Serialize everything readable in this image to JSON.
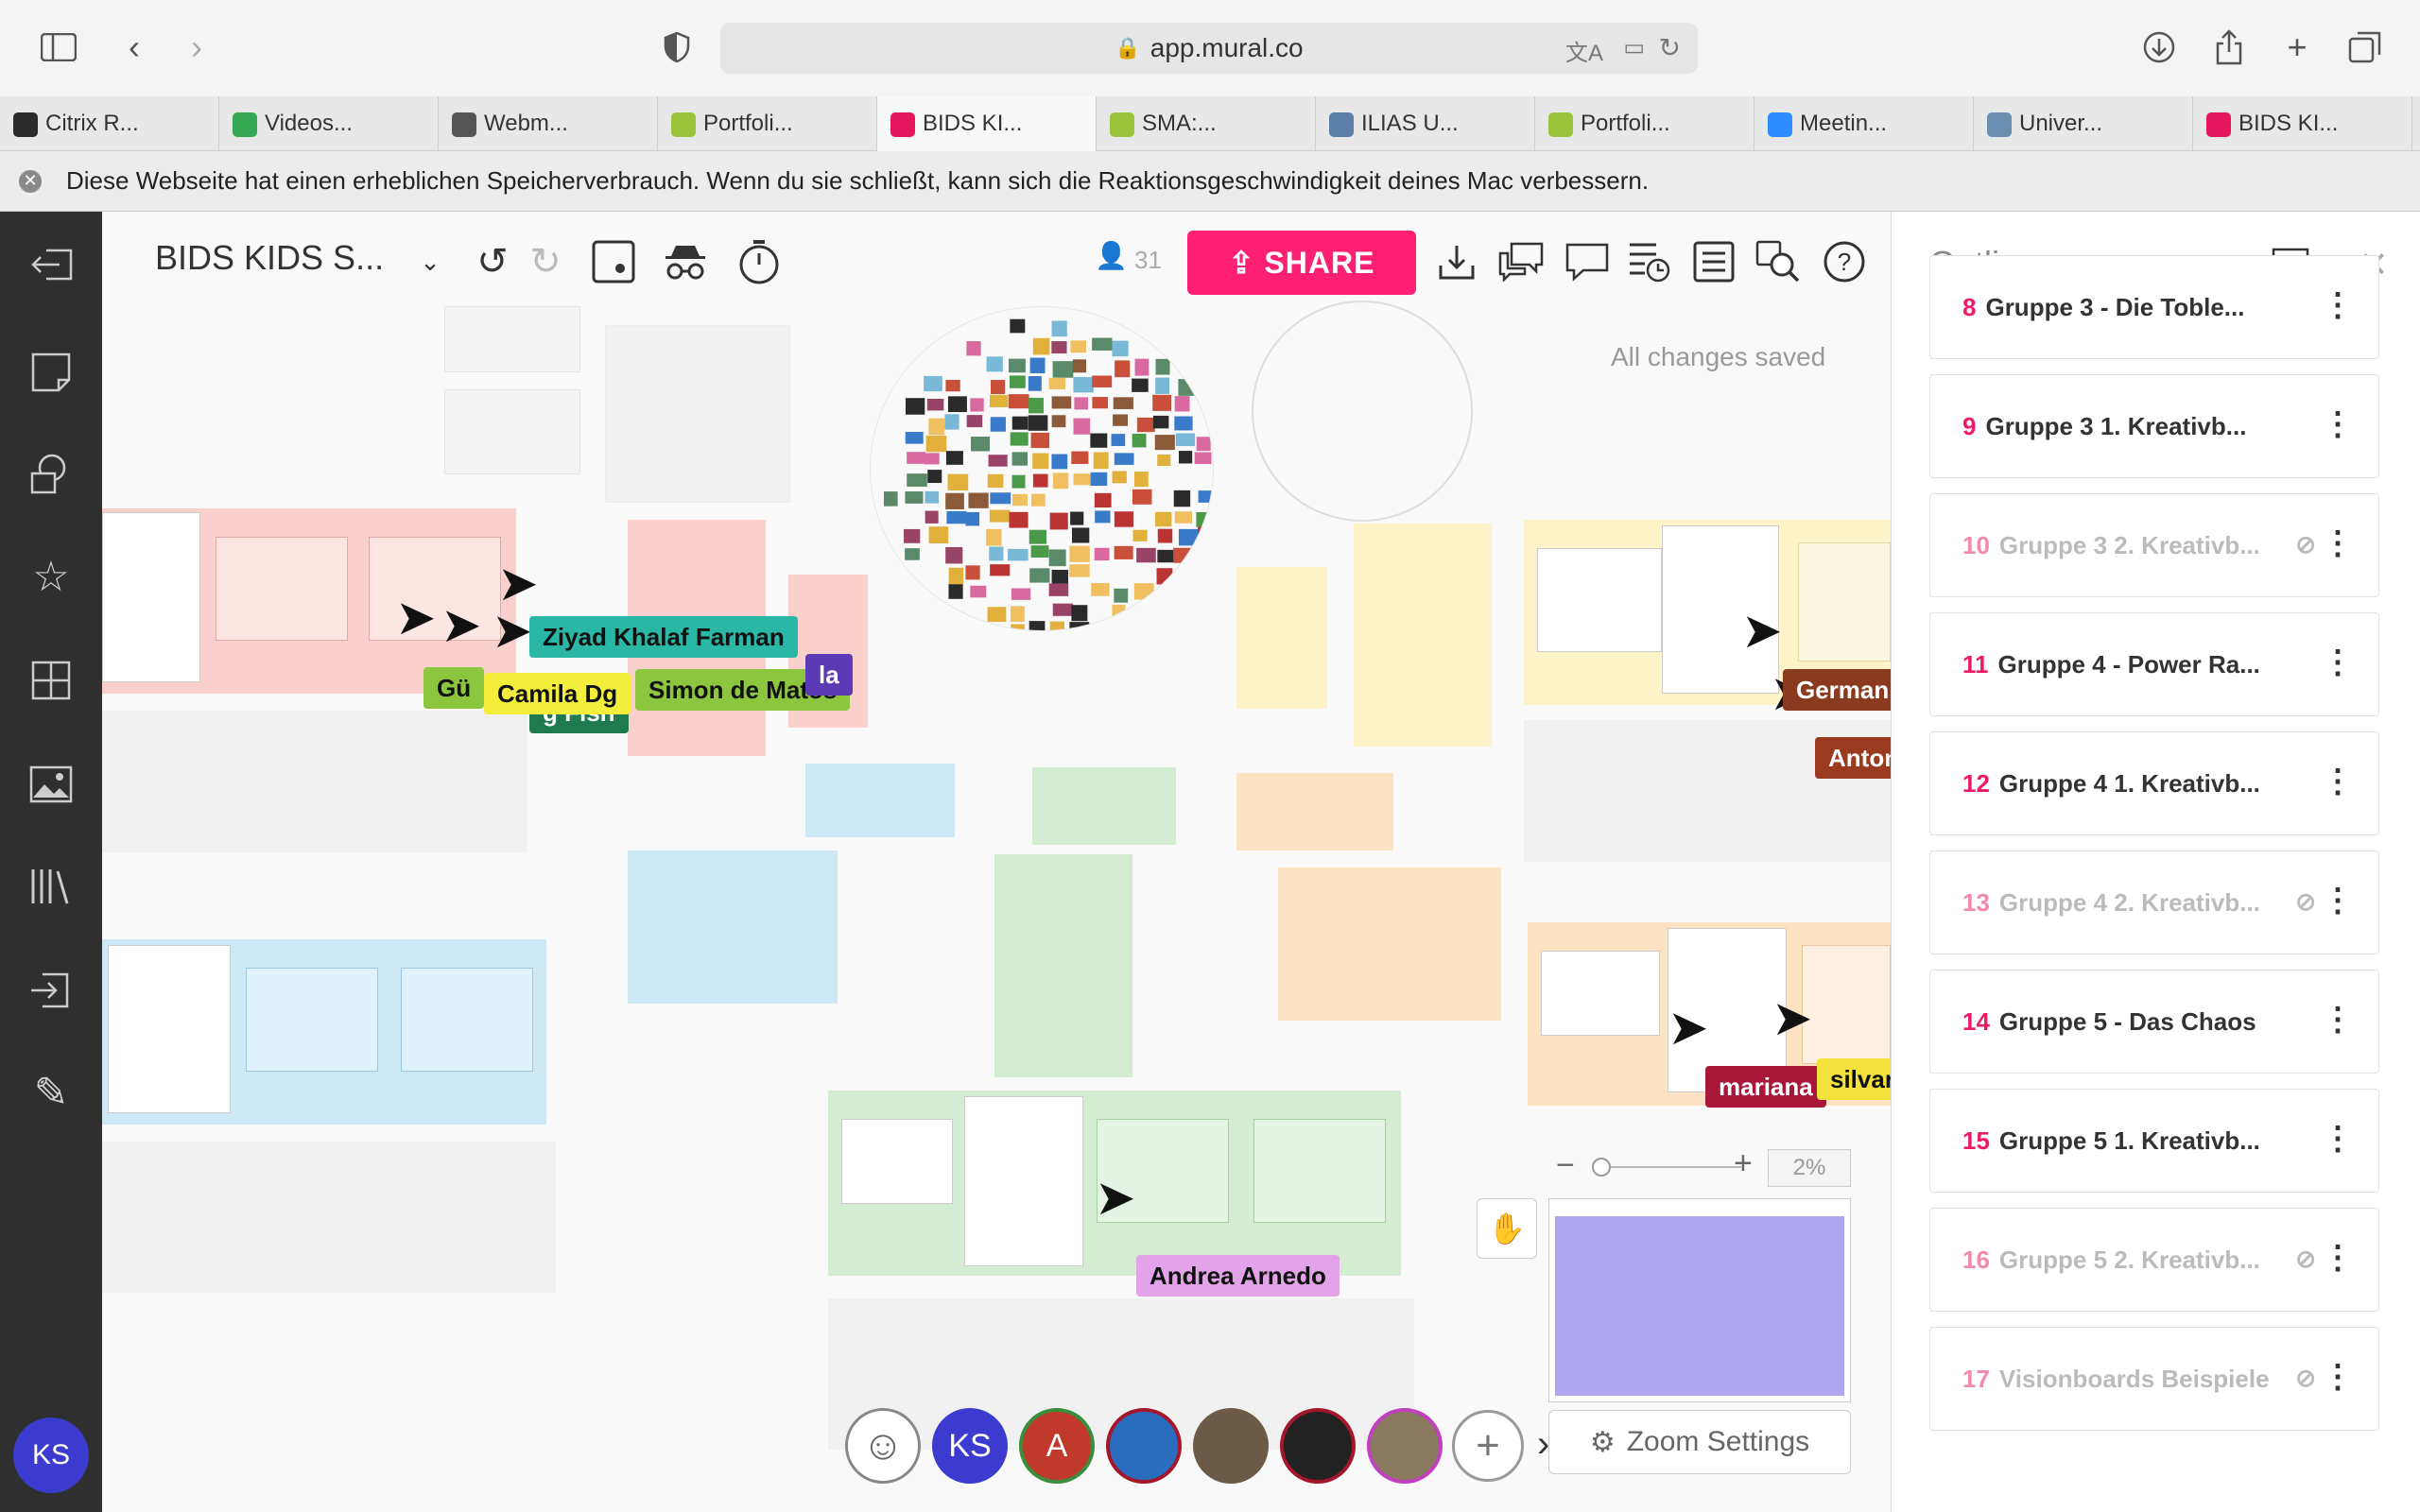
{
  "browser": {
    "url": "app.mural.co",
    "tabs": [
      {
        "label": "Citrix R...",
        "color": "#2b2b2b"
      },
      {
        "label": "Videos...",
        "color": "#34a853"
      },
      {
        "label": "Webm...",
        "color": "#555555"
      },
      {
        "label": "Portfoli...",
        "color": "#9bc53d"
      },
      {
        "label": "BIDS KI...",
        "color": "#e5175e"
      },
      {
        "label": "SMA:...",
        "color": "#9bc53d"
      },
      {
        "label": "ILIAS U...",
        "color": "#5b7fa6"
      },
      {
        "label": "Portfoli...",
        "color": "#9bc53d"
      },
      {
        "label": "Meetin...",
        "color": "#2d8cff"
      },
      {
        "label": "Univer...",
        "color": "#6b8fb0"
      },
      {
        "label": "BIDS KI...",
        "color": "#e5175e"
      }
    ],
    "active_tab": 4,
    "warning": "Diese Webseite hat einen erheblichen Speicherverbrauch. Wenn du sie schließt, kann sich die Reaktionsgeschwindigkeit deines Mac verbessern."
  },
  "mural": {
    "title": "BIDS KIDS S...",
    "participant_count": "31",
    "share_label": "SHARE",
    "save_status": "All changes saved"
  },
  "outline": {
    "title": "Outline",
    "items": [
      {
        "num": "8",
        "label": "Gruppe 3 - Die Toble...",
        "hidden": false
      },
      {
        "num": "9",
        "label": "Gruppe 3 1. Kreativb...",
        "hidden": false
      },
      {
        "num": "10",
        "label": "Gruppe 3 2. Kreativb...",
        "hidden": true
      },
      {
        "num": "11",
        "label": "Gruppe 4 - Power Ra...",
        "hidden": false
      },
      {
        "num": "12",
        "label": "Gruppe 4 1. Kreativb...",
        "hidden": false
      },
      {
        "num": "13",
        "label": "Gruppe 4 2. Kreativb...",
        "hidden": true
      },
      {
        "num": "14",
        "label": "Gruppe 5 - Das Chaos",
        "hidden": false
      },
      {
        "num": "15",
        "label": "Gruppe 5 1. Kreativb...",
        "hidden": false
      },
      {
        "num": "16",
        "label": "Gruppe 5 2. Kreativb...",
        "hidden": true
      },
      {
        "num": "17",
        "label": "Visionboards Beispiele",
        "hidden": true
      }
    ]
  },
  "collaborators": [
    {
      "name": "Ziyad Khalaf Farman",
      "color": "#2bb7a6"
    },
    {
      "name": "Gü",
      "color": "#8cc63f"
    },
    {
      "name": "Camila Dg",
      "color": "#f2ee3b"
    },
    {
      "name": "Simon de Matos",
      "color": "#8cc63f"
    },
    {
      "name": "g Fish",
      "color": "#1f7a4f",
      "text_color": "#ffffff"
    },
    {
      "name": "la",
      "color": "#5b3bb5",
      "text_color": "#ffffff"
    },
    {
      "name": "German",
      "color": "#8a3a1e",
      "text_color": "#ffffff"
    },
    {
      "name": "Anton",
      "color": "#9a3a1e",
      "text_color": "#ffffff"
    },
    {
      "name": "mariana",
      "color": "#a8163a",
      "text_color": "#ffffff"
    },
    {
      "name": "silvar",
      "color": "#f2e23b"
    },
    {
      "name": "Andrea Arnedo",
      "color": "#e3a3e8"
    }
  ],
  "bottom": {
    "avatars": [
      {
        "label": "KS",
        "color": "#3b3ccf"
      },
      {
        "label": "A",
        "color": "#c0392b"
      }
    ],
    "zoom_percent": "2%",
    "zoom_settings_label": "Zoom Settings"
  },
  "sidebar_user_initials": "KS"
}
